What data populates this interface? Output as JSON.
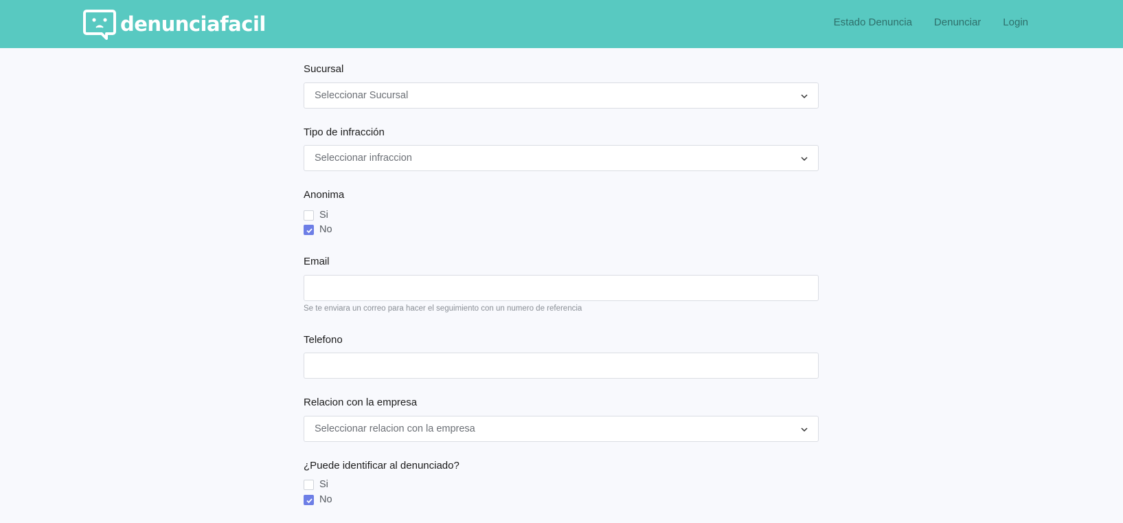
{
  "brand": {
    "name": "denunciafacil"
  },
  "nav": {
    "links": [
      "Estado Denuncia",
      "Denunciar",
      "Login"
    ]
  },
  "form": {
    "sucursal": {
      "label": "Sucursal",
      "placeholder": "Seleccionar Sucursal"
    },
    "tipo": {
      "label": "Tipo de infracción",
      "placeholder": "Seleccionar infraccion"
    },
    "anonima": {
      "label": "Anonima",
      "options": [
        {
          "label": "Si",
          "checked": false
        },
        {
          "label": "No",
          "checked": true
        }
      ]
    },
    "email": {
      "label": "Email",
      "value": "",
      "help": "Se te enviara un correo para hacer el seguimiento con un numero de referencia"
    },
    "telefono": {
      "label": "Telefono",
      "value": ""
    },
    "relacion": {
      "label": "Relacion con la empresa",
      "placeholder": "Seleccionar relacion con la empresa"
    },
    "identificar": {
      "label": "¿Puede identificar al denunciado?",
      "options": [
        {
          "label": "Si",
          "checked": false
        },
        {
          "label": "No",
          "checked": true
        }
      ]
    }
  },
  "colors": {
    "navbar": "#58c9c1",
    "nav_link": "#2e6f6a",
    "checkbox_checked": "#6d7ee6",
    "background": "#f8f9fd"
  },
  "icons": {
    "logo": "chat-bubble-face-icon",
    "select_caret": "chevron-down-icon",
    "check": "check-icon"
  }
}
